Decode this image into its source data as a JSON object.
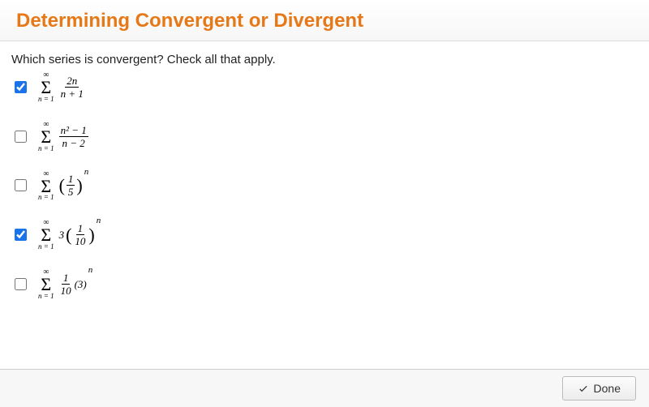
{
  "header": {
    "title": "Determining Convergent or Divergent"
  },
  "prompt": "Which series is convergent? Check all that apply.",
  "options": [
    {
      "checked": true,
      "upper": "∞",
      "lower": "n = 1",
      "expr": {
        "type": "frac",
        "num": "2n",
        "den": "n + 1"
      }
    },
    {
      "checked": false,
      "upper": "∞",
      "lower": "n = 1",
      "expr": {
        "type": "frac",
        "num": "n² − 1",
        "den": "n − 2"
      }
    },
    {
      "checked": false,
      "upper": "∞",
      "lower": "n = 1",
      "expr": {
        "type": "paren_pow",
        "inner_num": "1",
        "inner_den": "5",
        "power": "n"
      }
    },
    {
      "checked": true,
      "upper": "∞",
      "lower": "n = 1",
      "expr": {
        "type": "coef_paren_pow",
        "coef": "3",
        "inner_num": "1",
        "inner_den": "10",
        "power": "n"
      }
    },
    {
      "checked": false,
      "upper": "∞",
      "lower": "n = 1",
      "expr": {
        "type": "frac_times_pow",
        "num": "1",
        "den": "10",
        "base": "(3)",
        "power": "n"
      }
    }
  ],
  "footer": {
    "done": "Done"
  }
}
